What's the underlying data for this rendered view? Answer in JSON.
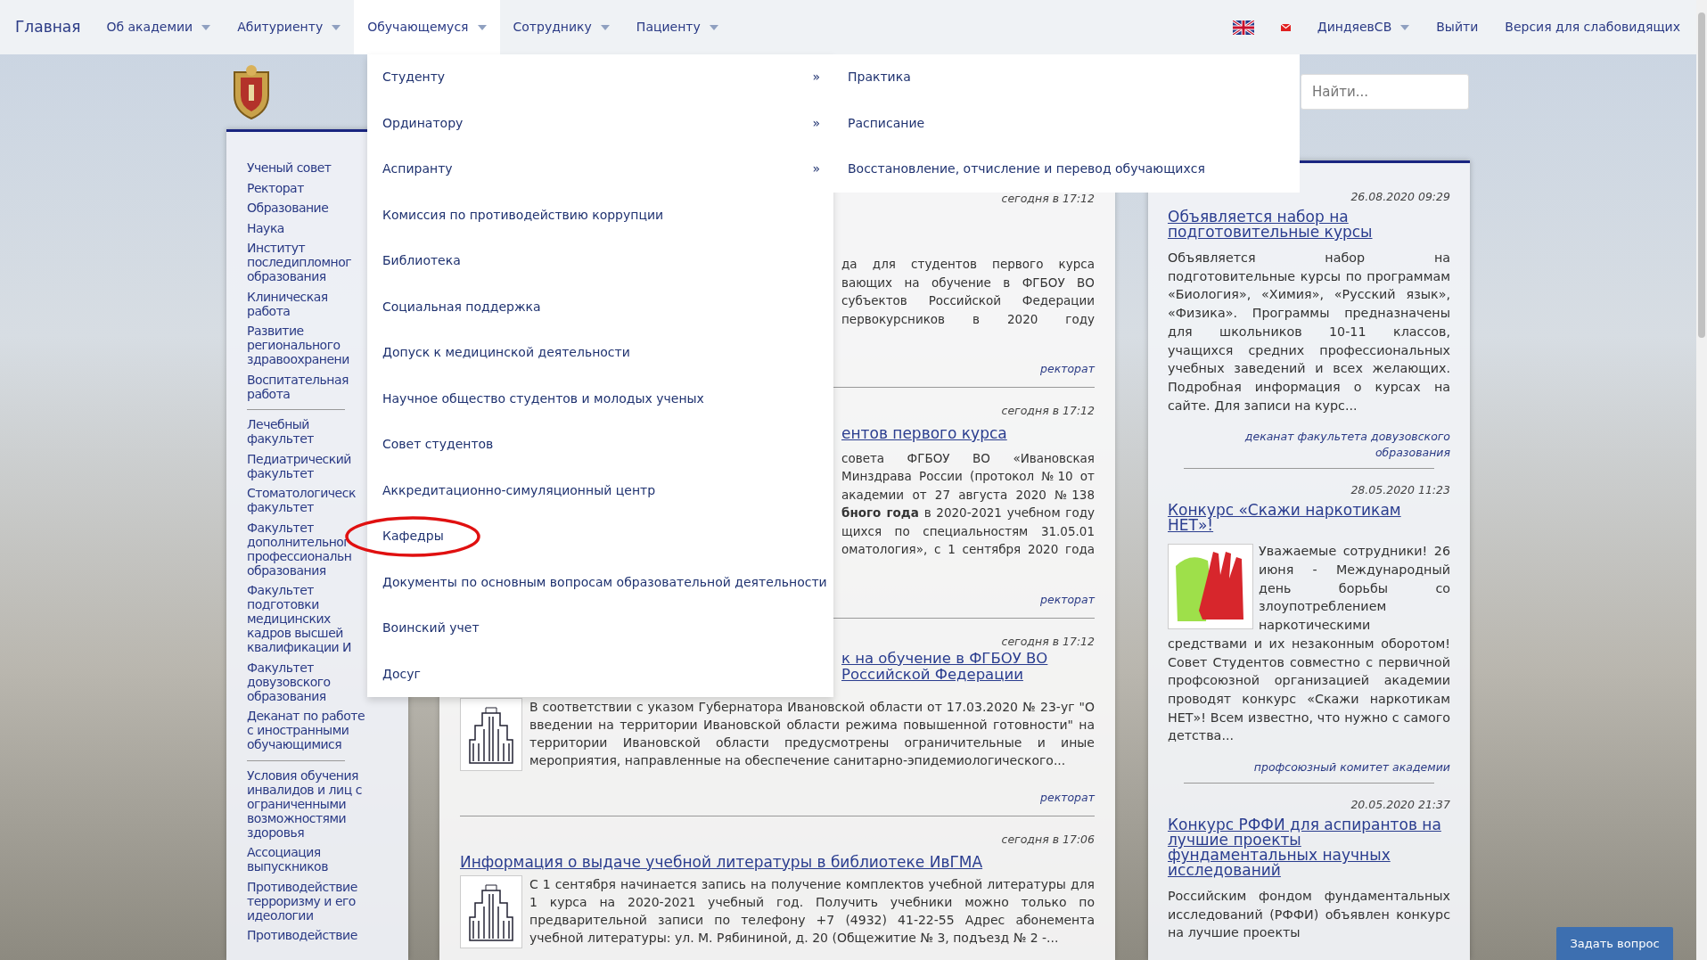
{
  "navbar": {
    "brand": "Главная",
    "items": [
      {
        "label": "Об академии",
        "selected": false,
        "dropdown": true
      },
      {
        "label": "Абитуриенту",
        "selected": false,
        "dropdown": true
      },
      {
        "label": "Обучающемуся",
        "selected": true,
        "dropdown": true
      },
      {
        "label": "Сотруднику",
        "selected": false,
        "dropdown": true
      },
      {
        "label": "Пациенту",
        "selected": false,
        "dropdown": true
      }
    ],
    "user": {
      "label": "ДиндяевСВ",
      "dropdown": true
    },
    "logout": "Выйти",
    "accessibility": "Версия для слабовидящих"
  },
  "dropdown": {
    "items": [
      {
        "label": "Студенту",
        "submenu_mark": "»",
        "circled": false
      },
      {
        "label": "Ординатору",
        "submenu_mark": "»",
        "circled": false
      },
      {
        "label": "Аспиранту",
        "submenu_mark": "»",
        "circled": false
      },
      {
        "label": "Комиссия по противодействию коррупции",
        "circled": false
      },
      {
        "label": "Библиотека",
        "circled": false
      },
      {
        "label": "Социальная поддержка",
        "circled": false
      },
      {
        "label": "Допуск к медицинской деятельности",
        "circled": false
      },
      {
        "label": "Научное общество студентов и молодых ученых",
        "circled": false
      },
      {
        "label": "Совет студентов",
        "circled": false
      },
      {
        "label": "Аккредитационно-симуляционный центр",
        "circled": false
      },
      {
        "label": "Кафедры",
        "circled": true
      },
      {
        "label": "Документы по основным вопросам образовательной деятельности",
        "circled": false
      },
      {
        "label": "Воинский учет",
        "circled": false
      },
      {
        "label": "Досуг",
        "circled": false
      }
    ]
  },
  "submenu": {
    "items": [
      "Практика",
      "Расписание",
      "Восстановление, отчисление и перевод обучающихся"
    ]
  },
  "search": {
    "placeholder": "Найти..."
  },
  "sidebar": {
    "groups": [
      [
        "Ученый совет",
        "Ректорат",
        "Образование",
        "Наука",
        "Институт\nпоследипломног\nобразования",
        "Клиническая\nработа",
        "Развитие\nрегионального\nздравоохранени",
        "Воспитательная\nработа"
      ],
      [
        "Лечебный\nфакультет",
        "Педиатрический\nфакультет",
        "Стоматологическ\nфакультет",
        "Факультет\nдополнительног\nпрофессиональн\nобразования",
        "Факультет\nподготовки\nмедицинских\nкадров высшей\nквалификации И",
        "Факультет\nдовузовского\nобразования",
        "Деканат по работе\nс иностранными\nобучающимися"
      ],
      [
        "Условия обучения\nинвалидов и лиц с\nограниченными\nвозможностями\nздоровья",
        "Ассоциация\nвыпускников",
        "Противодействие\nтерроризму и его\nидеологии",
        "Противодействие"
      ]
    ]
  },
  "news": [
    {
      "kind": "fragment",
      "date": "сегодня в 17:12",
      "body_lines": [
        "да для студентов первого курса",
        "вающих на обучение в ФГБОУ ВО",
        "субъектов Российской Федерации",
        "первокурсников в 2020 году"
      ],
      "author": "ректорат"
    },
    {
      "kind": "fragment",
      "date": "сегодня в 17:12",
      "title_lines": [
        "ентов первого курса"
      ],
      "body_lines": [
        "совета ФГБОУ ВО «Ивановская",
        "Минздрава России (протокол №10 от",
        "академии от 27 августа 2020 №138",
        "**бного года** в 2020-2021 учебном году",
        "щихся по специальностям 31.05.01",
        "оматология», с 1 сентября 2020 года"
      ],
      "author": "ректорат"
    },
    {
      "kind": "fragment_image",
      "date": "сегодня в 17:12",
      "title_lines": [
        "к на обучение в ФГБОУ ВО",
        "Российской Федерации"
      ],
      "body": "В соответствии с указом Губернатора Ивановской области от 17.03.2020 № 23-уг \"О введении на территории Ивановской области режима повышенной готовности\" на территории Ивановской области предусмотрены ограничительные и иные мероприятия, направленные на обеспечение санитарно-эпидемиологического...",
      "author": "ректорат"
    },
    {
      "kind": "full",
      "date": "сегодня в 17:06",
      "title": "Информация о выдаче учебной литературы в библиотеке ИвГМА",
      "body": "С 1 сентября начинается запись на получение комплектов учебной литературы для 1 курса на 2020-2021 учебный год. Получить учебники можно только по предварительной записи по телефону +7 (4932) 41-22-55 Адрес абонемента учебной литературы: ул. М. Рябининой, д. 20 (Общежитие № 3, подъезд № 2 -..."
    }
  ],
  "announcements": [
    {
      "date": "26.08.2020 09:29",
      "title": "Объявляется набор на подготовительные курсы",
      "body": "Объявляется набор на подготовительные курсы по программам «Биология», «Химия», «Русский язык», «Физика». Программы предназначены для школьников 10-11 классов, учащихся средних профессиональных учебных заведений и всех желающих. Подробная информация о курсах на сайте. Для записи на курс...",
      "author": "деканат факультета довузовского образования"
    },
    {
      "date": "28.05.2020 11:23",
      "title": "Конкурс «Скажи наркотикам НЕТ»!",
      "image": true,
      "body": "Уважаемые сотрудники! 26 июня - Международный день борьбы со злоупотреблением наркотическими",
      "body_below": "средствами и их незаконным оборотом! Совет Студентов совместно с первичной профсоюзной организацией академии проводят конкурс «Скажи наркотикам НЕТ»! Всем известно, что нужно с самого детства...",
      "author": "профсоюзный комитет академии"
    },
    {
      "date": "20.05.2020 21:37",
      "title": "Конкурс РФФИ для аспирантов на лучшие проекты фундаментальных научных исследований",
      "body": "Российским фондом фундаментальных исследований (РФФИ) объявлен конкурс на лучшие проекты"
    }
  ],
  "ask_button": "Задать вопрос"
}
